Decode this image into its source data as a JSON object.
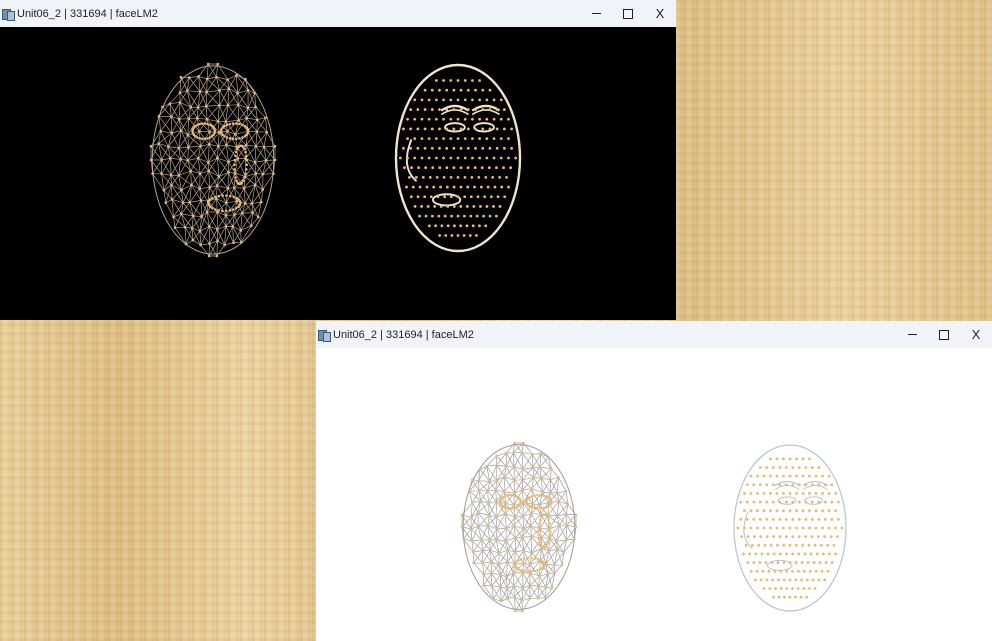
{
  "window_top": {
    "title": "Unit06_2 | 331694 | faceLM2",
    "minimize_icon": "minimize-icon",
    "maximize_icon": "maximize-icon",
    "close_label": "X",
    "canvas_background": "#000000"
  },
  "window_bottom": {
    "title": "Unit06_2 | 331694 | faceLM2",
    "minimize_icon": "minimize-icon",
    "maximize_icon": "maximize-icon",
    "close_label": "X",
    "canvas_background": "#ffffff"
  },
  "colors": {
    "landmark_points": "#e7b978",
    "contours_dark_bg": "#f1e4cf",
    "mesh_dark_bg": "#b3a590",
    "mesh_light_bg": "#9c9c9c",
    "contours_light_bg": "#b9c6d2",
    "desktop": "#e6c993"
  }
}
